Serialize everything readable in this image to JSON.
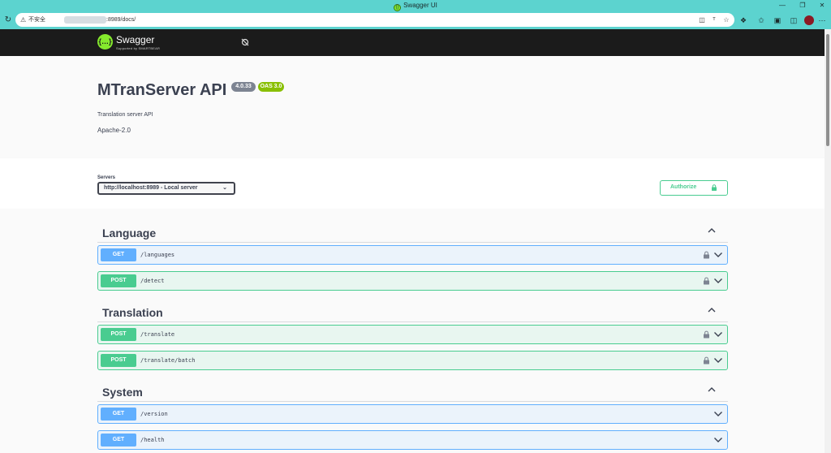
{
  "browser": {
    "window_title": "Swagger UI",
    "favicon_glyph": "{}",
    "insecure_label": "不安全",
    "url_visible": ":8989/docs/",
    "icons": [
      "reload-icon",
      "warning-icon",
      "translate-icon",
      "read-aloud-icon",
      "favorite-star-icon",
      "extensions-icon",
      "favorites-icon",
      "collections-icon",
      "sidebar-icon",
      "profile-avatar",
      "more-icon",
      "minimize-icon",
      "restore-icon",
      "close-icon"
    ]
  },
  "swagger_topbar": {
    "logo_glyph": "{…}",
    "logo_text": "Swagger",
    "logo_subtext": "Supported by SMARTBEAR",
    "brand_color": "#85ea2d"
  },
  "info": {
    "title": "MTranServer API",
    "version_badge": "4.0.33",
    "oas_badge": "OAS 3.0",
    "description": "Translation server API",
    "license": "Apache-2.0"
  },
  "servers": {
    "label": "Servers",
    "selected": "http://localhost:8989 - Local server"
  },
  "authorize": {
    "label": "Authorize"
  },
  "colors": {
    "get": "#61affe",
    "post": "#49cc90",
    "text": "#3b4151"
  },
  "tags": [
    {
      "name": "Language",
      "operations": [
        {
          "method": "GET",
          "path": "/languages",
          "locked": true
        },
        {
          "method": "POST",
          "path": "/detect",
          "locked": true
        }
      ]
    },
    {
      "name": "Translation",
      "operations": [
        {
          "method": "POST",
          "path": "/translate",
          "locked": true
        },
        {
          "method": "POST",
          "path": "/translate/batch",
          "locked": true
        }
      ]
    },
    {
      "name": "System",
      "operations": [
        {
          "method": "GET",
          "path": "/version",
          "locked": false
        },
        {
          "method": "GET",
          "path": "/health",
          "locked": false
        }
      ]
    }
  ]
}
